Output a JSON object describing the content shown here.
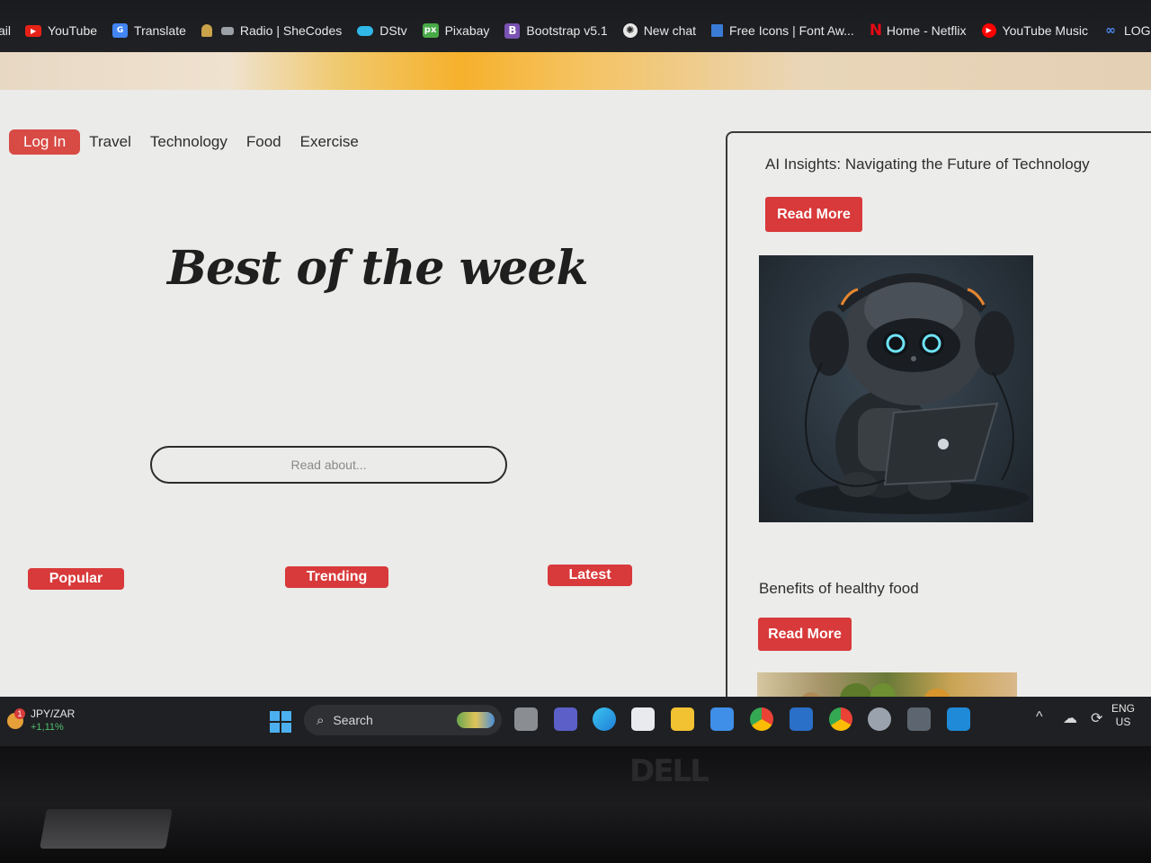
{
  "bookmarks": [
    {
      "label": "ail",
      "icon": "mail-icon",
      "color": "#ea4335"
    },
    {
      "label": "YouTube",
      "icon": "youtube-icon",
      "color": "#e62117"
    },
    {
      "label": "Translate",
      "icon": "translate-icon",
      "color": "#4285f4"
    },
    {
      "label": "",
      "icon": "lock-icon",
      "color": "#c9a24a"
    },
    {
      "label": "Radio | SheCodes",
      "icon": "folder-icon",
      "color": "#9aa0a6"
    },
    {
      "label": "DStv",
      "icon": "dstv-icon",
      "color": "#2fb8e8"
    },
    {
      "label": "Pixabay",
      "icon": "pixabay-icon",
      "color": "#48a947"
    },
    {
      "label": "Bootstrap v5.1",
      "icon": "bootstrap-icon",
      "color": "#7952b3"
    },
    {
      "label": "New chat",
      "icon": "chatgpt-icon",
      "color": "#e8e8e8"
    },
    {
      "label": "Free Icons | Font Aw...",
      "icon": "flag-icon",
      "color": "#3a7bd5"
    },
    {
      "label": "Home - Netflix",
      "icon": "netflix-icon",
      "color": "#e50914"
    },
    {
      "label": "YouTube Music",
      "icon": "youtube-music-icon",
      "color": "#ff0000"
    },
    {
      "label": "LOGO.com",
      "icon": "logo-com-icon",
      "color": "#4d8bf5"
    }
  ],
  "nav": {
    "login": "Log In",
    "items": [
      "Travel",
      "Technology",
      "Food",
      "Exercise"
    ]
  },
  "hero": {
    "title": "Best of the week",
    "search_placeholder": "Read about..."
  },
  "tags": [
    "Popular",
    "Trending",
    "Latest"
  ],
  "sidebar": {
    "posts": [
      {
        "title": "AI Insights: Navigating the Future of Technology",
        "button": "Read More"
      },
      {
        "title": "Benefits of healthy food",
        "button": "Read More"
      }
    ]
  },
  "taskbar": {
    "ticker_name": "JPY/ZAR",
    "ticker_change": "+1,11%",
    "ticker_badge": "1",
    "search_label": "Search",
    "lang_top": "ENG",
    "lang_bottom": "US"
  },
  "colors": {
    "accent_red": "#d8393a",
    "login_red": "#d84a44",
    "page_bg": "#ebebe9"
  }
}
